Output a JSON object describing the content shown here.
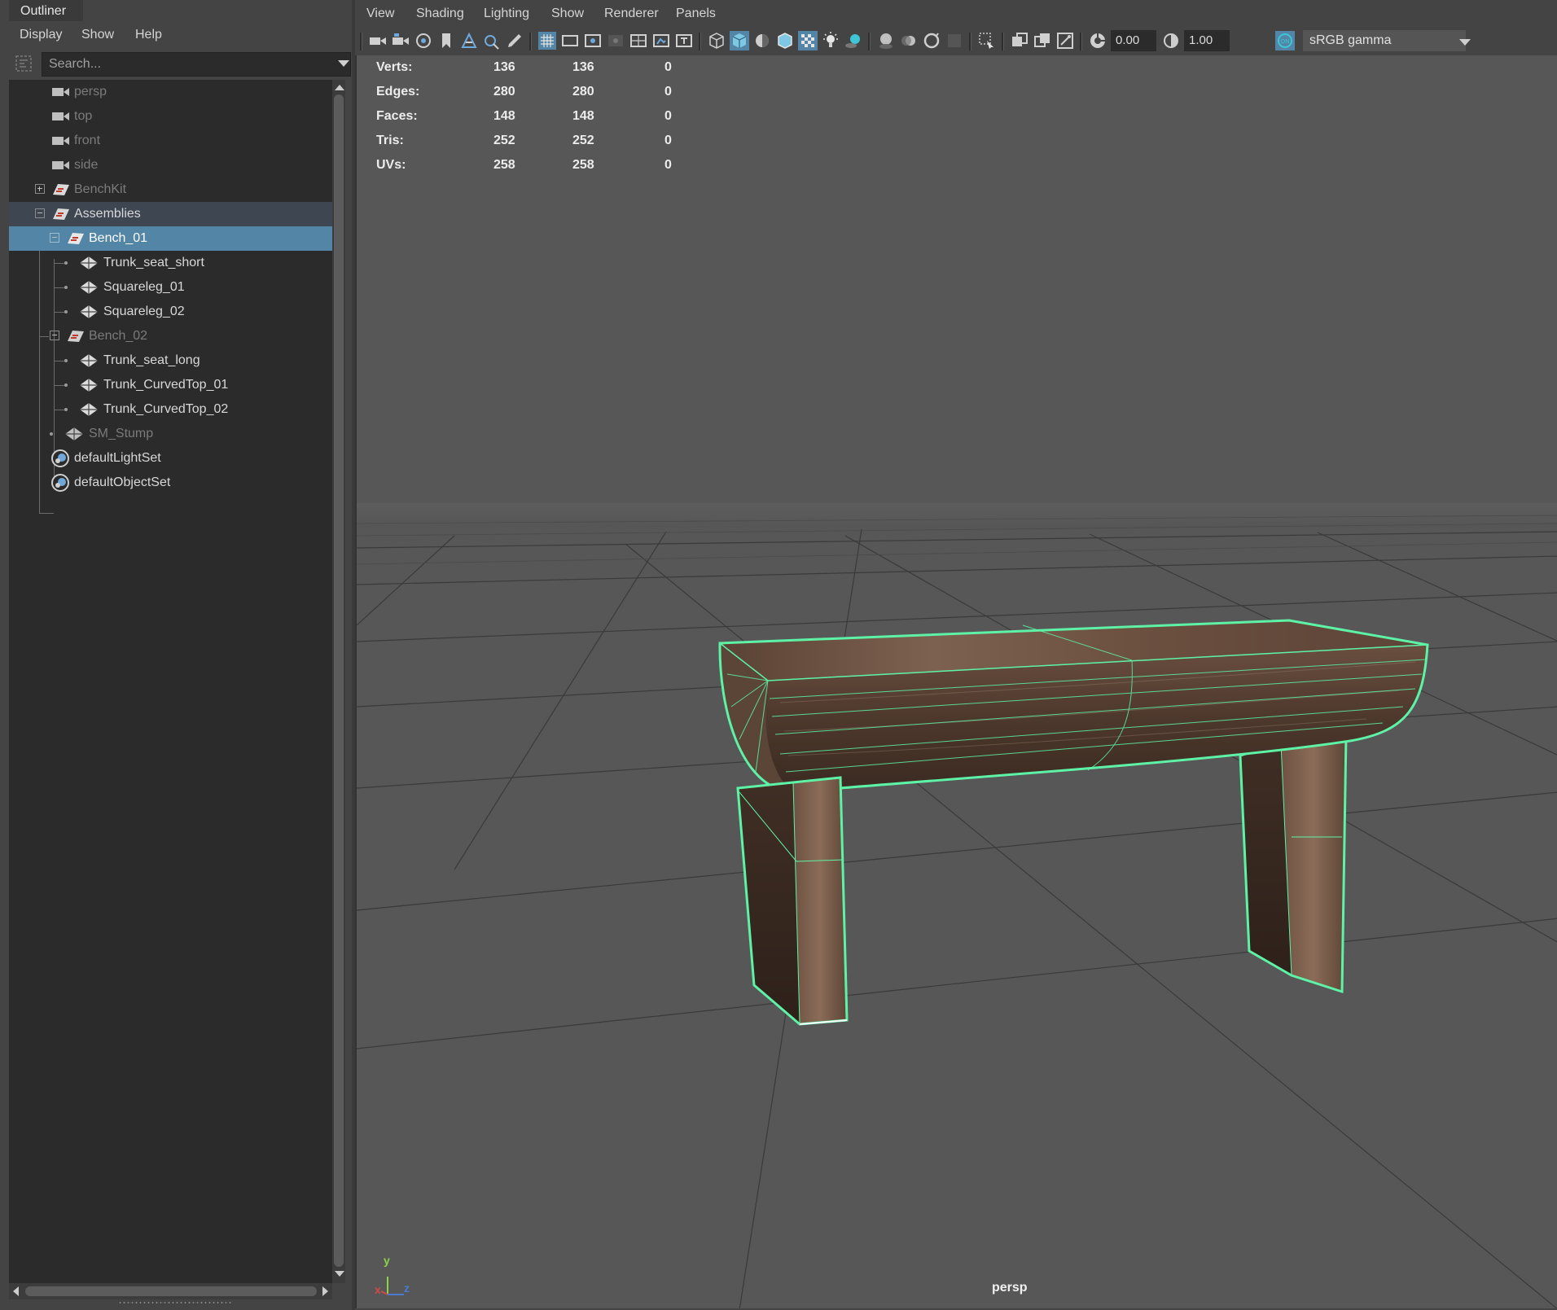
{
  "outliner": {
    "tab_label": "Outliner",
    "menu": [
      "Display",
      "Show",
      "Help"
    ],
    "search_placeholder": "Search...",
    "items": [
      {
        "label": "persp",
        "icon": "camera-icon"
      },
      {
        "label": "top",
        "icon": "camera-icon"
      },
      {
        "label": "front",
        "icon": "camera-icon"
      },
      {
        "label": "side",
        "icon": "camera-icon"
      },
      {
        "label": "BenchKit",
        "icon": "assembly-icon"
      },
      {
        "label": "Assemblies",
        "icon": "assembly-icon"
      },
      {
        "label": "Bench_01",
        "icon": "assembly-icon"
      },
      {
        "label": "Trunk_seat_short",
        "icon": "mesh-icon"
      },
      {
        "label": "Squareleg_01",
        "icon": "mesh-icon"
      },
      {
        "label": "Squareleg_02",
        "icon": "mesh-icon"
      },
      {
        "label": "Bench_02",
        "icon": "assembly-icon"
      },
      {
        "label": "Trunk_seat_long",
        "icon": "mesh-icon"
      },
      {
        "label": "Trunk_CurvedTop_01",
        "icon": "mesh-icon"
      },
      {
        "label": "Trunk_CurvedTop_02",
        "icon": "mesh-icon"
      },
      {
        "label": "SM_Stump",
        "icon": "mesh-icon"
      },
      {
        "label": "defaultLightSet",
        "icon": "set-icon"
      },
      {
        "label": "defaultObjectSet",
        "icon": "set-icon"
      }
    ],
    "selected_item": "Bench_01"
  },
  "viewport": {
    "menu": [
      "View",
      "Shading",
      "Lighting",
      "Show",
      "Renderer",
      "Panels"
    ],
    "exposure_value": "0.00",
    "gamma_value": "1.00",
    "color_space": "sRGB gamma",
    "camera_name": "persp",
    "hud": [
      {
        "label": "Verts:",
        "values": [
          "136",
          "136",
          "0"
        ]
      },
      {
        "label": "Edges:",
        "values": [
          "280",
          "280",
          "0"
        ]
      },
      {
        "label": "Faces:",
        "values": [
          "148",
          "148",
          "0"
        ]
      },
      {
        "label": "Tris:",
        "values": [
          "252",
          "252",
          "0"
        ]
      },
      {
        "label": "UVs:",
        "values": [
          "258",
          "258",
          "0"
        ]
      }
    ],
    "axis_labels": {
      "y": "y",
      "x": "x",
      "z": "z"
    },
    "colors": {
      "selection_wireframe": "#5ef2a6",
      "viewport_background": "#575757",
      "wood_dark": "#4a3528",
      "wood_light": "#8a6c58"
    }
  }
}
